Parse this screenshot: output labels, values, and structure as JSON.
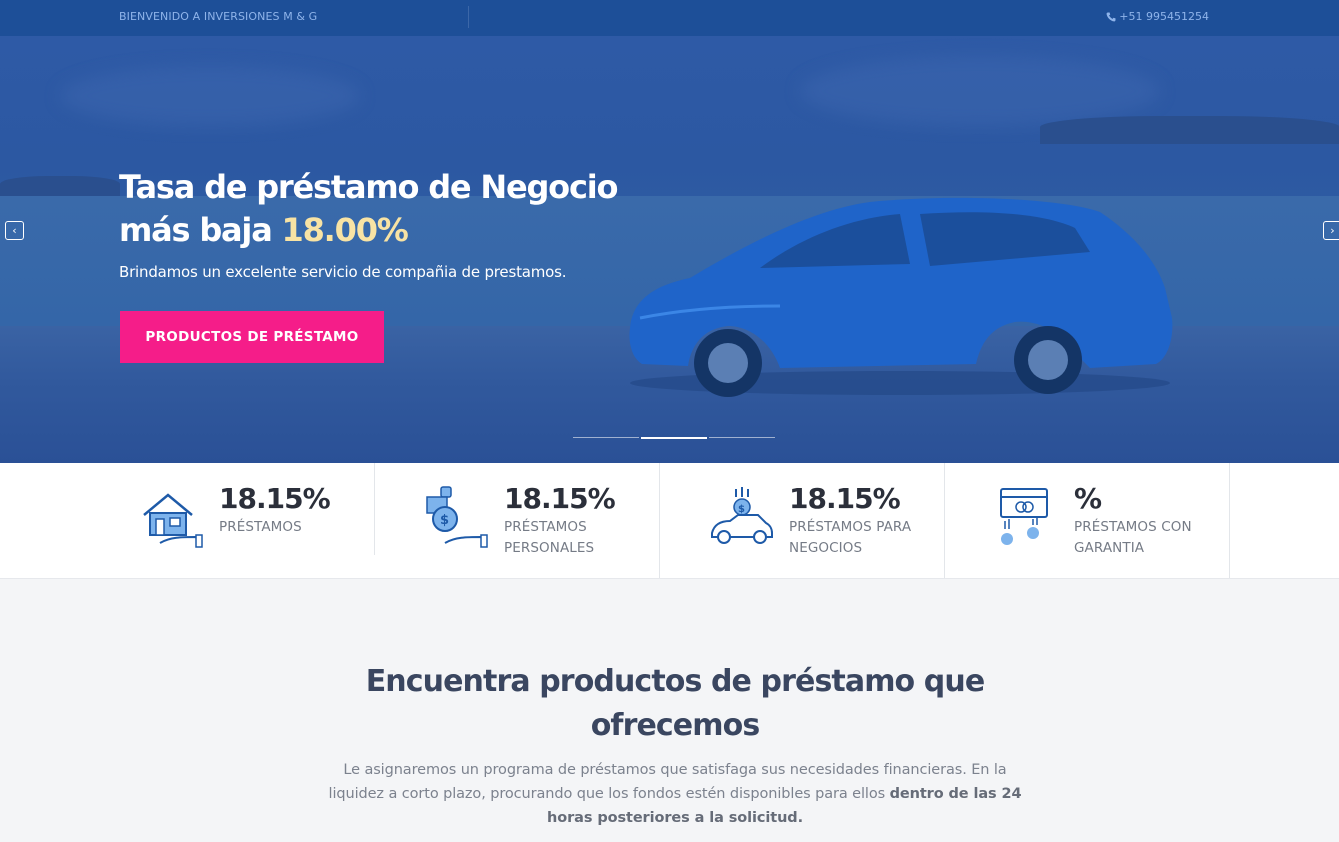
{
  "topbar": {
    "welcome": "BIENVENIDO A INVERSIONES M & G",
    "phone": "+51 995451254",
    "phone_icon": "phone-icon"
  },
  "hero": {
    "title_main": "Tasa de préstamo de Negocio más baja",
    "title_rate": "18.00%",
    "subtitle": "Brindamos un excelente servicio de compañia de prestamos.",
    "cta_label": "PRODUCTOS DE PRÉSTAMO",
    "prev_icon": "chevron-left-icon",
    "next_icon": "chevron-right-icon",
    "slides": 3,
    "active_slide": 2
  },
  "stats": [
    {
      "value": "18.15%",
      "label": "PRÉSTAMOS",
      "icon": "house-hand-icon"
    },
    {
      "value": "18.15%",
      "label": "PRÉSTAMOS PERSONALES",
      "icon": "money-bag-hand-icon"
    },
    {
      "value": "18.15%",
      "label": "PRÉSTAMOS PARA NEGOCIOS",
      "icon": "car-coin-icon"
    },
    {
      "value": "%",
      "label": "PRÉSTAMOS CON GARANTIA",
      "icon": "credit-card-coins-icon"
    }
  ],
  "section": {
    "title": "Encuentra productos de préstamo que ofrecemos",
    "text": "Le asignaremos un programa de préstamos que satisfaga sus necesidades financieras. En la liquidez a corto plazo, procurando que los fondos estén disponibles para ellos",
    "text_bold": "dentro de las 24 horas posteriores a la solicitud."
  },
  "colors": {
    "topbar_bg": "#1d4f98",
    "hero_overlay": "#2c58a2",
    "cta": "#f51d89",
    "rate_accent": "#f8e3a4",
    "icon_blue": "#1e5aa8",
    "icon_light": "#7db3ec"
  }
}
